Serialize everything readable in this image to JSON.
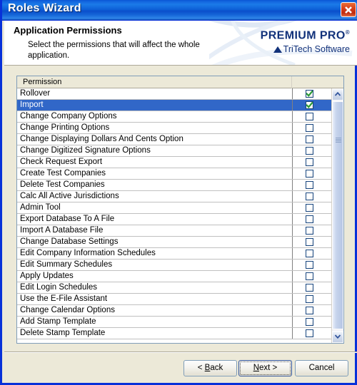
{
  "window": {
    "title": "Roles Wizard",
    "close_icon": "close-x-icon",
    "titlebar_color": "#0a55d4",
    "frame_color": "#0831d9",
    "face_color": "#ece9d8"
  },
  "header": {
    "title": "Application Permissions",
    "subtitle": "Select the permissions that will affect the whole application.",
    "logo": {
      "main": "PREMIUM PRO",
      "registered_mark": "®",
      "tagline": "TriTech Software",
      "triangle_icon": "triangle-up-icon",
      "brand_color": "#11317a"
    }
  },
  "grid": {
    "columns": [
      "Permission",
      ""
    ],
    "checkbox_checked_color": "#2a9a34",
    "checkbox_border_color": "#17457e",
    "selection_color": "#3167c8",
    "rows": [
      {
        "permission": "Rollover",
        "checked": true,
        "selected": false
      },
      {
        "permission": "Import",
        "checked": true,
        "selected": true
      },
      {
        "permission": "Change Company Options",
        "checked": false,
        "selected": false
      },
      {
        "permission": "Change Printing Options",
        "checked": false,
        "selected": false
      },
      {
        "permission": "Change Displaying Dollars And Cents Option",
        "checked": false,
        "selected": false
      },
      {
        "permission": "Change Digitized Signature Options",
        "checked": false,
        "selected": false
      },
      {
        "permission": "Check Request Export",
        "checked": false,
        "selected": false
      },
      {
        "permission": "Create Test Companies",
        "checked": false,
        "selected": false
      },
      {
        "permission": "Delete Test Companies",
        "checked": false,
        "selected": false
      },
      {
        "permission": "Calc All Active Jurisdictions",
        "checked": false,
        "selected": false
      },
      {
        "permission": "Admin Tool",
        "checked": false,
        "selected": false
      },
      {
        "permission": "Export Database To A File",
        "checked": false,
        "selected": false
      },
      {
        "permission": "Import A Database File",
        "checked": false,
        "selected": false
      },
      {
        "permission": "Change Database Settings",
        "checked": false,
        "selected": false
      },
      {
        "permission": "Edit Company Information Schedules",
        "checked": false,
        "selected": false
      },
      {
        "permission": "Edit Summary Schedules",
        "checked": false,
        "selected": false
      },
      {
        "permission": "Apply Updates",
        "checked": false,
        "selected": false
      },
      {
        "permission": "Edit Login Schedules",
        "checked": false,
        "selected": false
      },
      {
        "permission": "Use the E-File Assistant",
        "checked": false,
        "selected": false
      },
      {
        "permission": "Change Calendar Options",
        "checked": false,
        "selected": false
      },
      {
        "permission": "Add Stamp Template",
        "checked": false,
        "selected": false
      },
      {
        "permission": "Delete Stamp Template",
        "checked": false,
        "selected": false
      }
    ]
  },
  "scrollbar": {
    "up_icon": "chevron-up-icon",
    "down_icon": "chevron-down-icon",
    "grip_icon": "grip-lines-icon"
  },
  "footer": {
    "back": {
      "prefix": "< ",
      "accel": "B",
      "suffix": "ack"
    },
    "next": {
      "prefix": "",
      "accel": "N",
      "suffix": "ext >"
    },
    "cancel": {
      "label": "Cancel"
    }
  }
}
